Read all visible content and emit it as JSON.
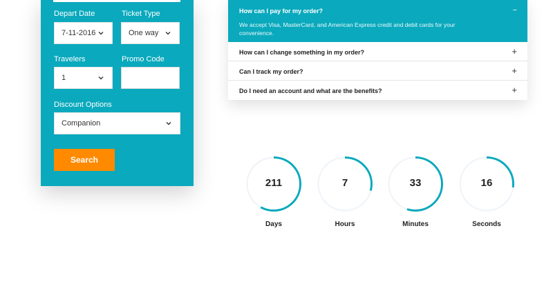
{
  "booking": {
    "depart_date": {
      "label": "Depart Date",
      "value": "7-11-2016"
    },
    "ticket_type": {
      "label": "Ticket Type",
      "value": "One way"
    },
    "travelers": {
      "label": "Travelers",
      "value": "1"
    },
    "promo_code": {
      "label": "Promo Code",
      "value": ""
    },
    "discount_options": {
      "label": "Discount Options",
      "value": "Companion"
    },
    "search_label": "Search"
  },
  "faq": {
    "open_item": {
      "question": "How can I pay for my order?",
      "answer": "We accept Visa, MasterCard, and American Express credit and debit cards for your convenience.",
      "toggle": "−"
    },
    "items": [
      {
        "question": "How can I change something in my order?",
        "toggle": "+"
      },
      {
        "question": "Can I track my order?",
        "toggle": "+"
      },
      {
        "question": "Do I need an account and what are the benefits?",
        "toggle": "+"
      }
    ]
  },
  "countdown": {
    "accent_color": "#0aa9bd",
    "track_color": "#eef3f8",
    "units": [
      {
        "value": "211",
        "label": "Days",
        "progress": 0.58
      },
      {
        "value": "7",
        "label": "Hours",
        "progress": 0.29
      },
      {
        "value": "33",
        "label": "Minutes",
        "progress": 0.55
      },
      {
        "value": "16",
        "label": "Seconds",
        "progress": 0.27
      }
    ]
  }
}
